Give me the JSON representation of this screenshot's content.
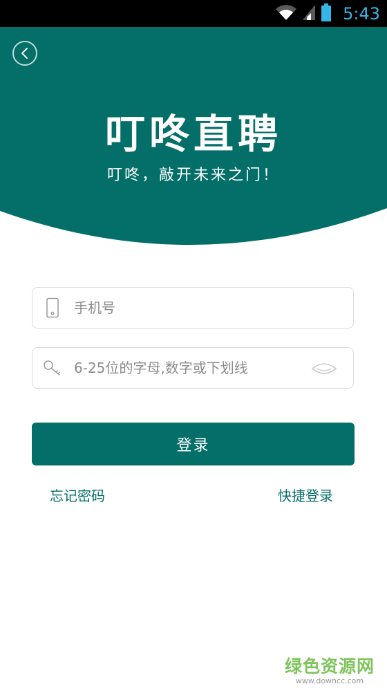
{
  "status_bar": {
    "time": "5:43",
    "icons": [
      "wifi-icon",
      "signal-icon",
      "battery-icon"
    ]
  },
  "header": {
    "title": "叮咚直聘",
    "slogan": "叮咚，敲开未来之门！",
    "bg_color": "#046e68"
  },
  "form": {
    "phone_placeholder": "手机号",
    "password_placeholder": "6-25位的字母,数字或下划线",
    "login_label": "登录",
    "forgot_password": "忘记密码",
    "quick_login": "快捷登录"
  },
  "watermark": {
    "main": "绿色资源网",
    "url": "www.downcc.com"
  },
  "colors": {
    "primary": "#046e68",
    "watermark": "#7fc35c"
  }
}
